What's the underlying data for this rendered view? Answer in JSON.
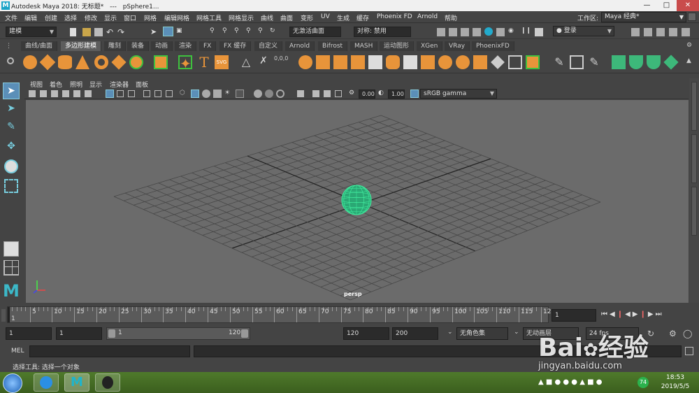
{
  "window": {
    "app_title": "Autodesk Maya 2018: 无标题*",
    "separator": "---",
    "object": "pSphere1..."
  },
  "menubar": [
    "文件",
    "编辑",
    "创建",
    "选择",
    "修改",
    "显示",
    "窗口",
    "网格",
    "编辑网格",
    "网格工具",
    "网格显示",
    "曲线",
    "曲面",
    "变形",
    "UV",
    "生成",
    "缓存",
    "Phoenix FD",
    "Arnold",
    "帮助"
  ],
  "workspace": {
    "label": "工作区:",
    "value": "Maya 经典*"
  },
  "statusline": {
    "mode": "建模",
    "live_surface": "无激活曲面",
    "symmetry": "对称: 禁用",
    "login": "登录"
  },
  "shelf_tabs": [
    "曲线/曲面",
    "多边形建模",
    "雕刻",
    "装备",
    "动画",
    "渲染",
    "FX",
    "FX 缓存",
    "自定义",
    "Arnold",
    "Bifrost",
    "MASH",
    "运动图形",
    "XGen",
    "VRay",
    "PhoenixFD"
  ],
  "shelf_active": "多边形建模",
  "panel_menu": [
    "视图",
    "着色",
    "照明",
    "显示",
    "渲染器",
    "面板"
  ],
  "panel_tools": {
    "exposure": "0.00",
    "gamma": "1.00",
    "color_space": "sRGB gamma"
  },
  "viewport": {
    "camera": "persp",
    "sphere_color": "#3fe59a"
  },
  "timeline": {
    "ticks": [
      5,
      10,
      15,
      20,
      25,
      30,
      35,
      40,
      45,
      50,
      55,
      60,
      65,
      70,
      75,
      80,
      85,
      90,
      95,
      100,
      105,
      110,
      115,
      12
    ],
    "start_tick": "1",
    "current_frame": "1"
  },
  "range": {
    "start": "1",
    "playback_start": "1",
    "slider_start": "1",
    "slider_end": "120",
    "playback_end": "120",
    "end": "200",
    "char_set": "无角色集",
    "anim_layer": "无动画层",
    "fps": "24 fps"
  },
  "cmdline": {
    "label": "MEL"
  },
  "helpline": "选择工具: 选择一个对象",
  "taskbar": {
    "time": "18:53",
    "date": "2019/5/5",
    "badge": "74"
  },
  "watermark": {
    "brand": "Bai",
    "brand2": "经验",
    "url": "jingyan.baidu.com"
  }
}
